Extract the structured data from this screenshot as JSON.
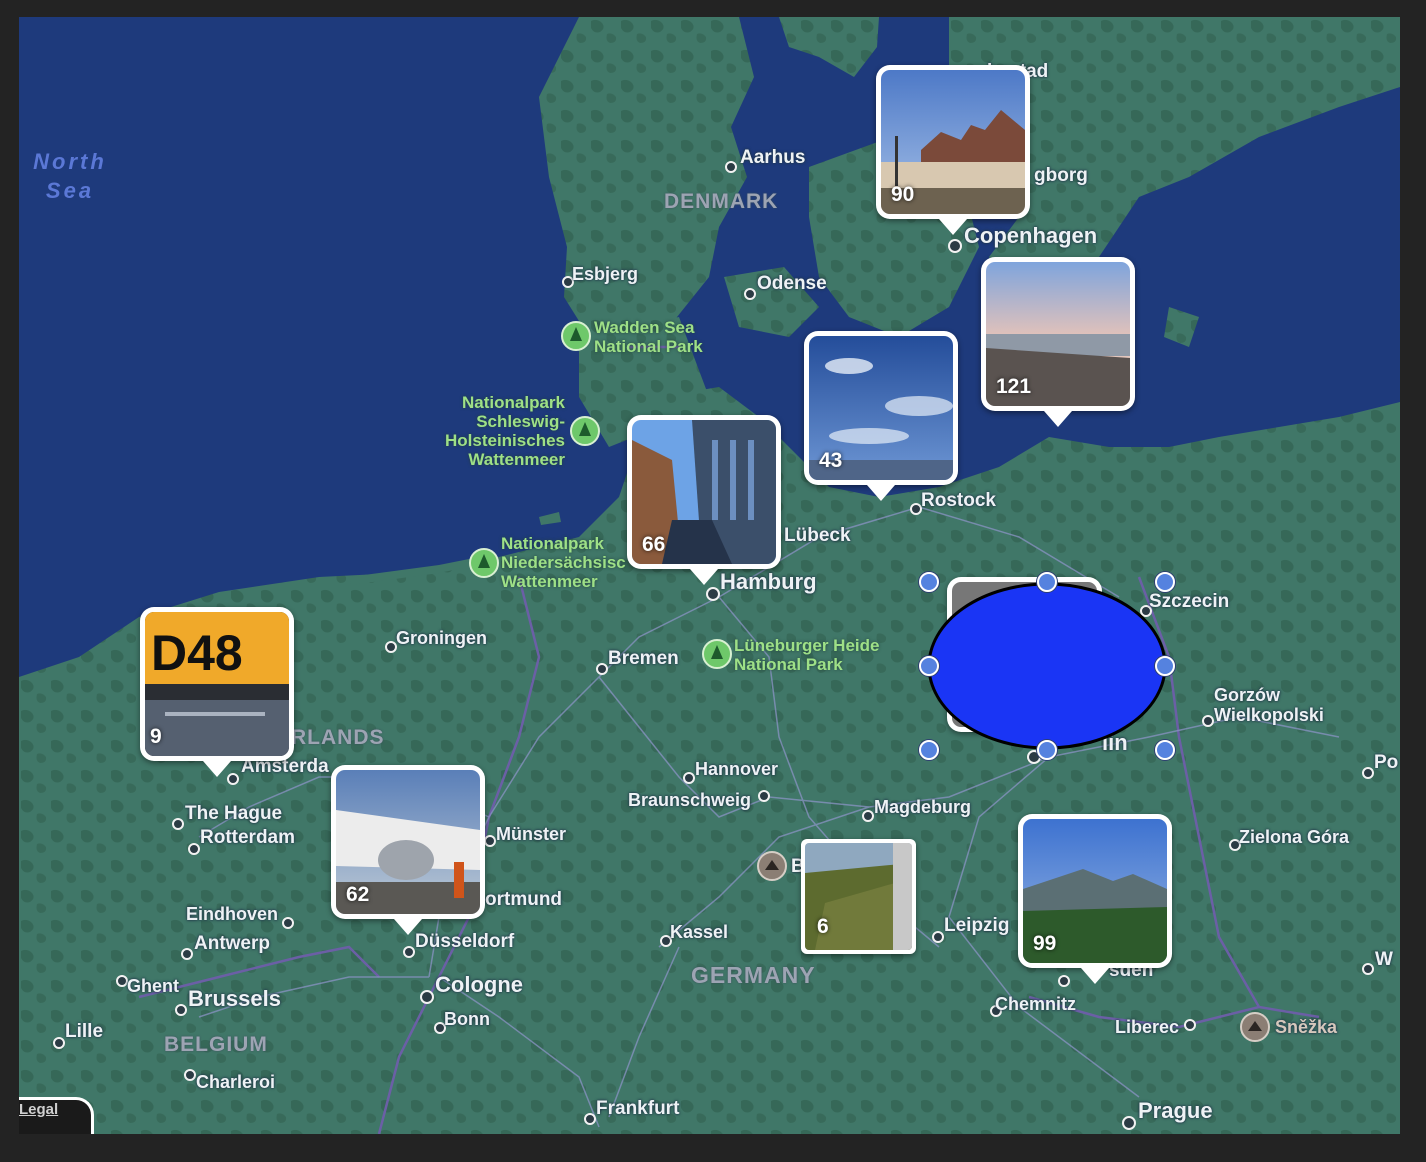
{
  "map": {
    "seas": [
      {
        "id": "north-sea",
        "text": "North\nSea"
      }
    ],
    "countries": {
      "denmark": "DENMARK",
      "germany": "GERMANY",
      "belgium": "BELGIUM",
      "netherlands_partial": "RLANDS"
    },
    "cities": {
      "aarhus": "Aarhus",
      "helsingborg_partial": "gborg",
      "halmstad_partial": "lmstad",
      "copenhagen": "Copenhagen",
      "esbjerg": "Esbjerg",
      "odense": "Odense",
      "rostock": "Rostock",
      "lubeck": "Lübeck",
      "hamburg": "Hamburg",
      "szczecin": "Szczecin",
      "groningen": "Groningen",
      "bremen": "Bremen",
      "gorzow": "Gorzów\nWielkopolski",
      "amsterdam_partial": "Amsterda",
      "berlin_partial": "lin",
      "hannover": "Hannover",
      "braunschweig": "Braunschweig",
      "magdeburg": "Magdeburg",
      "poznan_partial": "Po",
      "the_hague": "The Hague",
      "rotterdam": "Rotterdam",
      "munster": "Münster",
      "zielona_gora": "Zielona Góra",
      "dortmund_partial": "ortmund",
      "eindhoven": "Eindhoven",
      "antwerp": "Antwerp",
      "kassel": "Kassel",
      "leipzig": "Leipzig",
      "dusseldorf": "Düsseldorf",
      "dresden_partial": "sden",
      "wroclaw_partial": "W",
      "ghent": "Ghent",
      "brussels": "Brussels",
      "cologne": "Cologne",
      "chemnitz": "Chemnitz",
      "lille": "Lille",
      "bonn": "Bonn",
      "liberec": "Liberec",
      "snezka": "Sněžka",
      "charleroi": "Charleroi",
      "frankfurt": "Frankfurt",
      "prague": "Prague",
      "brocken_partial": "B"
    },
    "parks": {
      "wadden": "Wadden Sea\nNational Park",
      "schleswig": "Nationalpark\nSchleswig-\nHolsteinisches\nWattenmeer",
      "niedersachsen": "Nationalpark\nNiedersächsisc\nWattenmeer",
      "luneburger": "Lüneburger Heide\nNational Park"
    },
    "legal": "Legal"
  },
  "photo_pins": [
    {
      "id": "copenhagen",
      "count": "90"
    },
    {
      "id": "baltic-beach",
      "count": "121"
    },
    {
      "id": "rostock-sky",
      "count": "43"
    },
    {
      "id": "hamburg-canal",
      "count": "66"
    },
    {
      "id": "amsterdam-gate",
      "count": "9"
    },
    {
      "id": "dusseldorf-plane",
      "count": "62"
    },
    {
      "id": "harz-train",
      "count": "6"
    },
    {
      "id": "saxon-switzerland",
      "count": "99"
    }
  ],
  "drawn_shape": {
    "type": "ellipse",
    "fill": "#1a35f5",
    "stroke": "#000000",
    "handle_color": "#5582df"
  },
  "colors": {
    "water": "#1e3a7c",
    "land": "#3f7466",
    "border": "#6b5fa6"
  }
}
